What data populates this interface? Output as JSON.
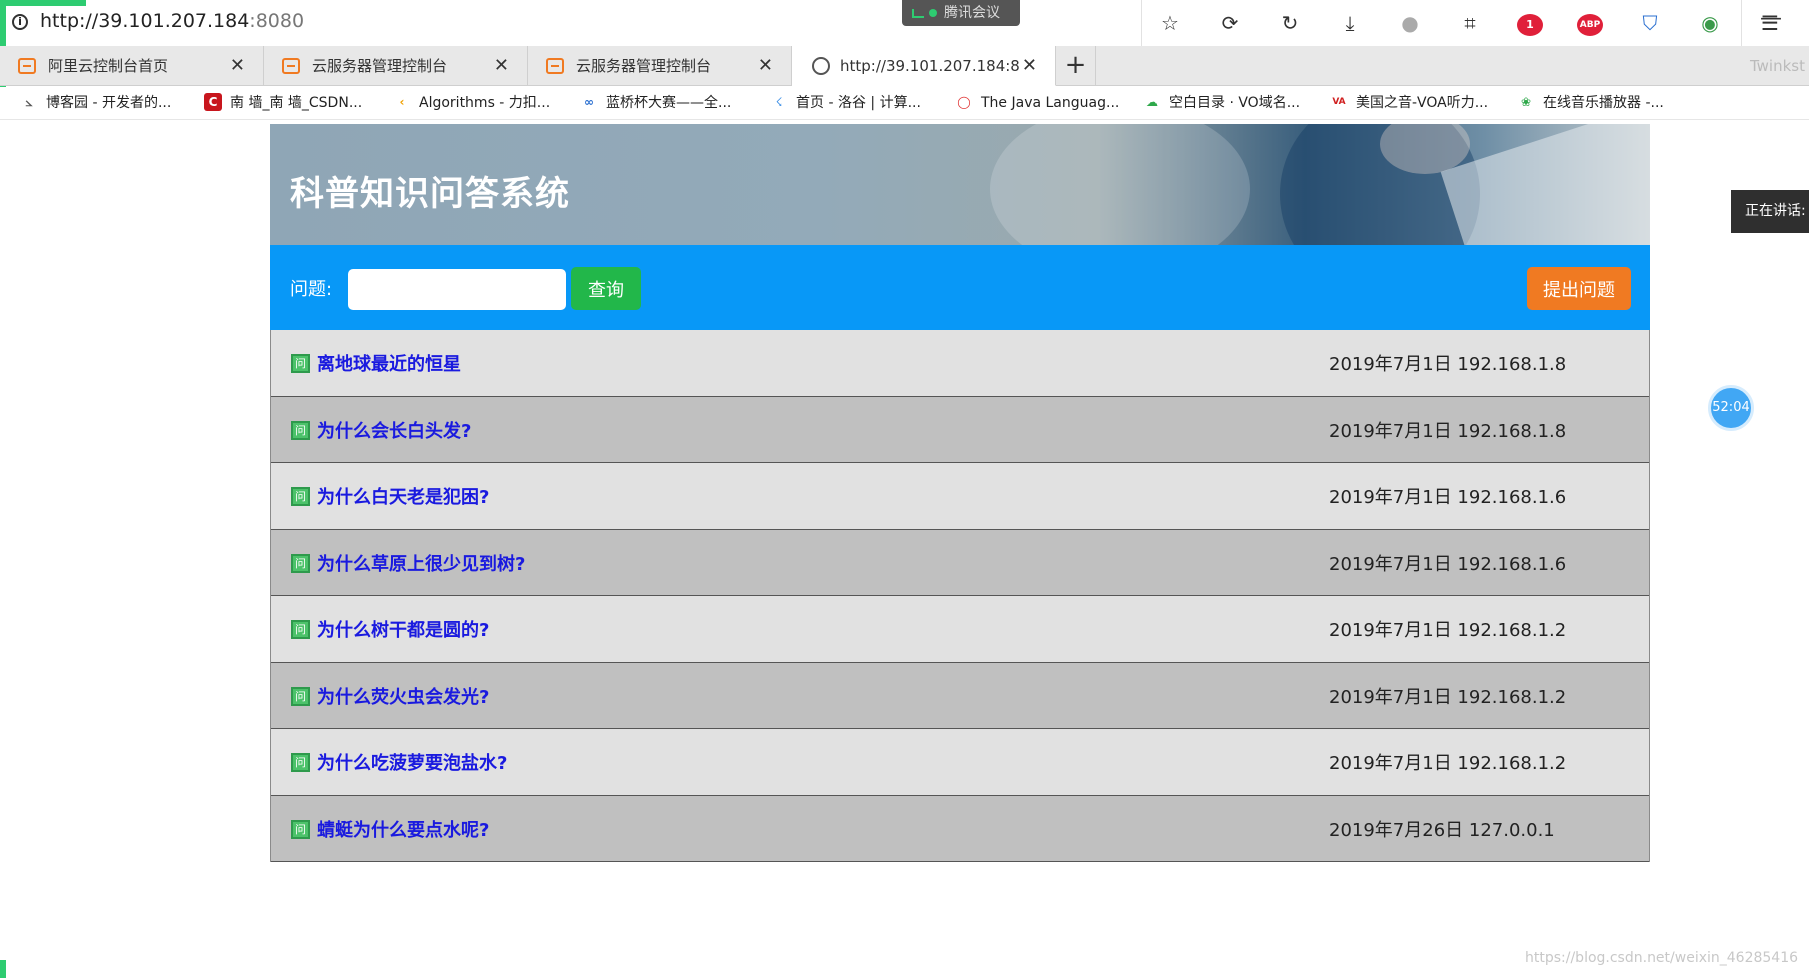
{
  "browser": {
    "url_host": "http://39.101.207.184",
    "url_port": ":8080",
    "meeting_app": "腾讯会议",
    "notification_count": "1",
    "abp_label": "ABP",
    "tabs": [
      {
        "label": "阿里云控制台首页",
        "close": "✕"
      },
      {
        "label": "云服务器管理控制台",
        "close": "✕"
      },
      {
        "label": "云服务器管理控制台",
        "close": "✕"
      },
      {
        "label": "http://39.101.207.184:8",
        "close": "✕"
      }
    ],
    "new_tab": "+",
    "tab_overflow": "Twinkst",
    "bookmarks": [
      {
        "label": "博客园 - 开发者的...",
        "icon_text": "⦣",
        "color": "#555555"
      },
      {
        "label": "南 墙_南 墙_CSDN...",
        "icon_text": "C",
        "color": "#c8161d"
      },
      {
        "label": "Algorithms - 力扣...",
        "icon_text": "‹",
        "color": "#f0a000"
      },
      {
        "label": "蓝桥杯大赛——全...",
        "icon_text": "∞",
        "color": "#2a6fd0"
      },
      {
        "label": "首页 - 洛谷 | 计算...",
        "icon_text": "☇",
        "color": "#3a8ee6"
      },
      {
        "label": "The Java Languag...",
        "icon_text": "◯",
        "color": "#e03030"
      },
      {
        "label": "空白目录 · VO域名...",
        "icon_text": "☁",
        "color": "#2ea84a"
      },
      {
        "label": "美国之音-VOA听力...",
        "icon_text": "VA",
        "color": "#d02020"
      },
      {
        "label": "在线音乐播放器 -...",
        "icon_text": "❀",
        "color": "#2ea84a"
      }
    ]
  },
  "app": {
    "title": "科普知识问答系统",
    "search": {
      "label": "问题:",
      "placeholder": "",
      "button": "查询"
    },
    "ask_button": "提出问题",
    "icon_text": "问",
    "questions": [
      {
        "title": "离地球最近的恒星",
        "meta": "2019年7月1日 192.168.1.8"
      },
      {
        "title": "为什么会长白头发?",
        "meta": "2019年7月1日 192.168.1.8"
      },
      {
        "title": "为什么白天老是犯困?",
        "meta": "2019年7月1日 192.168.1.6"
      },
      {
        "title": "为什么草原上很少见到树?",
        "meta": "2019年7月1日 192.168.1.6"
      },
      {
        "title": "为什么树干都是圆的?",
        "meta": "2019年7月1日 192.168.1.2"
      },
      {
        "title": "为什么荧火虫会发光?",
        "meta": "2019年7月1日 192.168.1.2"
      },
      {
        "title": "为什么吃菠萝要泡盐水?",
        "meta": "2019年7月1日 192.168.1.2"
      },
      {
        "title": "蜻蜓为什么要点水呢?",
        "meta": "2019年7月26日 127.0.0.1"
      }
    ]
  },
  "overlay": {
    "speaking_label": "正在讲话:",
    "timer": "52:04",
    "watermark": "https://blog.csdn.net/weixin_46285416"
  },
  "colors": {
    "banner_blue": "#0898f7",
    "search_green": "#22b74a",
    "ask_orange": "#f07a22",
    "title_link_blue": "#1a1adf",
    "row_light": "#e1e1e1",
    "row_dark": "#c0c0c0"
  }
}
